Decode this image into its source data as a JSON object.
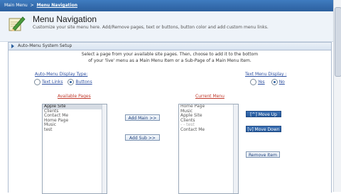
{
  "breadcrumb": {
    "root": "Main Menu",
    "separator": ">",
    "current": "Menu Navigation"
  },
  "header": {
    "title": "Menu Navigation",
    "description": "Customize your site menu here.  Add/Remove pages, text or buttons, button color and add custom menu links.",
    "icon": "pencil-notepad-icon"
  },
  "section": {
    "title": "Auto-Menu System Setup",
    "intro_line1": "Select a page from your available site pages.  Then, choose to add it to the bottom",
    "intro_line2": "of your 'live' menu as a Main Menu Item or a Sub-Page of a Main Menu Item."
  },
  "display_type": {
    "label": "Auto-Menu Display Type:",
    "options": [
      "Text Links",
      "Buttons"
    ],
    "selected": "Buttons"
  },
  "text_display": {
    "label": "Text Menu Display :",
    "options": [
      "Yes",
      "No"
    ],
    "selected": "No"
  },
  "available": {
    "header": "Available Pages",
    "items": [
      "Apple Site",
      "Clients",
      "Contact Me",
      "Home Page",
      "Music",
      "test"
    ],
    "selected": "Apple Site"
  },
  "current": {
    "header": "Current Menu",
    "items": [
      "Home Page",
      "Music",
      "Apple Site",
      "Clients",
      "- - test",
      "Contact Me"
    ]
  },
  "buttons": {
    "add_main": "Add Main >>",
    "add_sub": "Add Sub >>",
    "move_up": "[^] Move Up",
    "move_down": "[v] Move Down",
    "remove_item": "Remove Item"
  },
  "colors": {
    "accent": "#2c5f9e",
    "link_blue": "#2c4fa0",
    "link_red": "#c0392b"
  }
}
